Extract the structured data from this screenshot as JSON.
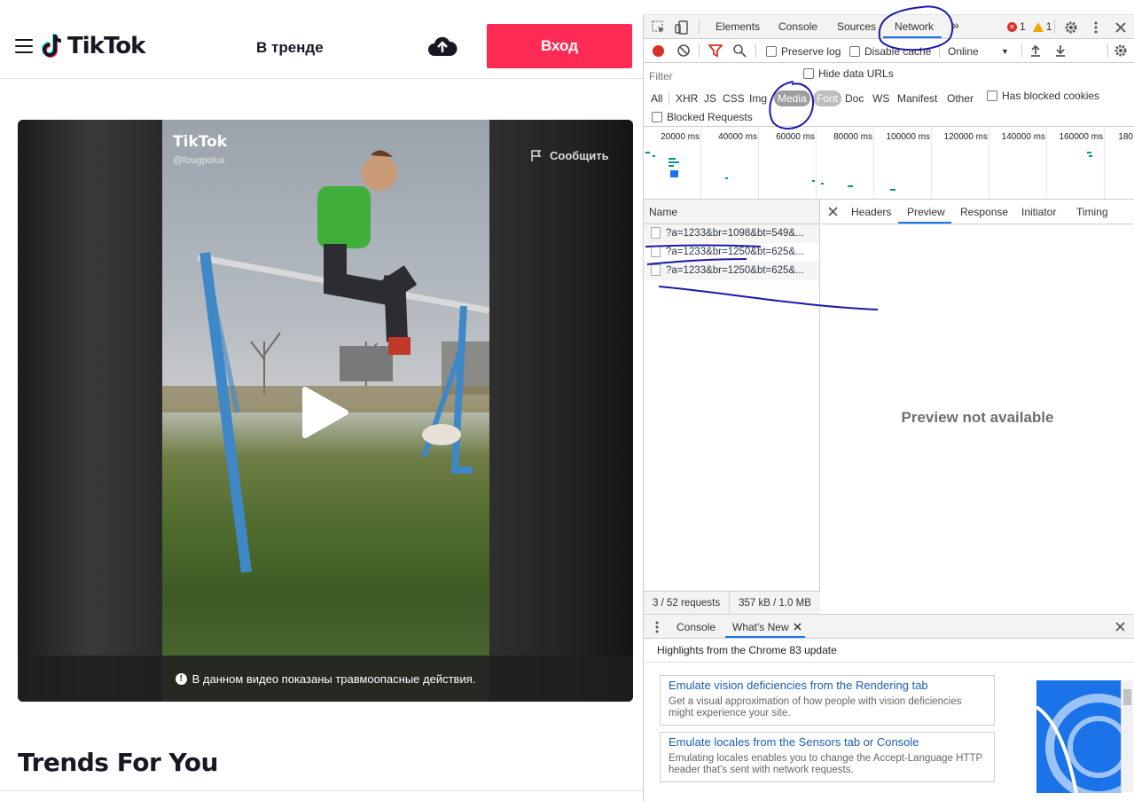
{
  "tiktok": {
    "logo_text": "TikTok",
    "trending_label": "В тренде",
    "login_button": "Вход",
    "watermark_logo": "TikTok",
    "watermark_user": "@fougpolux",
    "report_label": "Сообщить",
    "warning_text": "В данном видео показаны травмоопасные действия.",
    "trends_title": "Trends For You",
    "brand_color": "#fe2c55"
  },
  "devtools": {
    "tabs": [
      "Elements",
      "Console",
      "Sources",
      "Network"
    ],
    "active_tab": "Network",
    "more_tabs": "»",
    "errors": "1",
    "warnings": "1",
    "toolbar": {
      "preserve_log": "Preserve log",
      "disable_cache": "Disable cache",
      "throttle": "Online"
    },
    "filter": {
      "placeholder": "Filter",
      "hide_data_urls": "Hide data URLs",
      "types": [
        "All",
        "XHR",
        "JS",
        "CSS",
        "Img",
        "Media",
        "Font",
        "Doc",
        "WS",
        "Manifest",
        "Other"
      ],
      "selected_type": "Media",
      "has_blocked_cookies": "Has blocked cookies",
      "blocked_requests": "Blocked Requests"
    },
    "overview_ticks": [
      "20000 ms",
      "40000 ms",
      "60000 ms",
      "80000 ms",
      "100000 ms",
      "120000 ms",
      "140000 ms",
      "160000 ms",
      "180"
    ],
    "name_header": "Name",
    "requests": [
      "?a=1233&br=1098&bt=549&...",
      "?a=1233&br=1250&bt=625&...",
      "?a=1233&br=1250&bt=625&..."
    ],
    "summary_requests": "3 / 52 requests",
    "summary_size": "357 kB / 1.0 MB",
    "detail_tabs": [
      "Headers",
      "Preview",
      "Response",
      "Initiator",
      "Timing"
    ],
    "detail_active": "Preview",
    "preview_message": "Preview not available",
    "drawer": {
      "tabs": [
        "Console",
        "What's New"
      ],
      "active": "What's New",
      "subtitle": "Highlights from the Chrome 83 update",
      "cards": [
        {
          "title": "Emulate vision deficiencies from the Rendering tab",
          "desc": "Get a visual approximation of how people with vision deficiencies might experience your site."
        },
        {
          "title": "Emulate locales from the Sensors tab or Console",
          "desc": "Emulating locales enables you to change the Accept-Language HTTP header that's sent with network requests."
        }
      ]
    }
  }
}
